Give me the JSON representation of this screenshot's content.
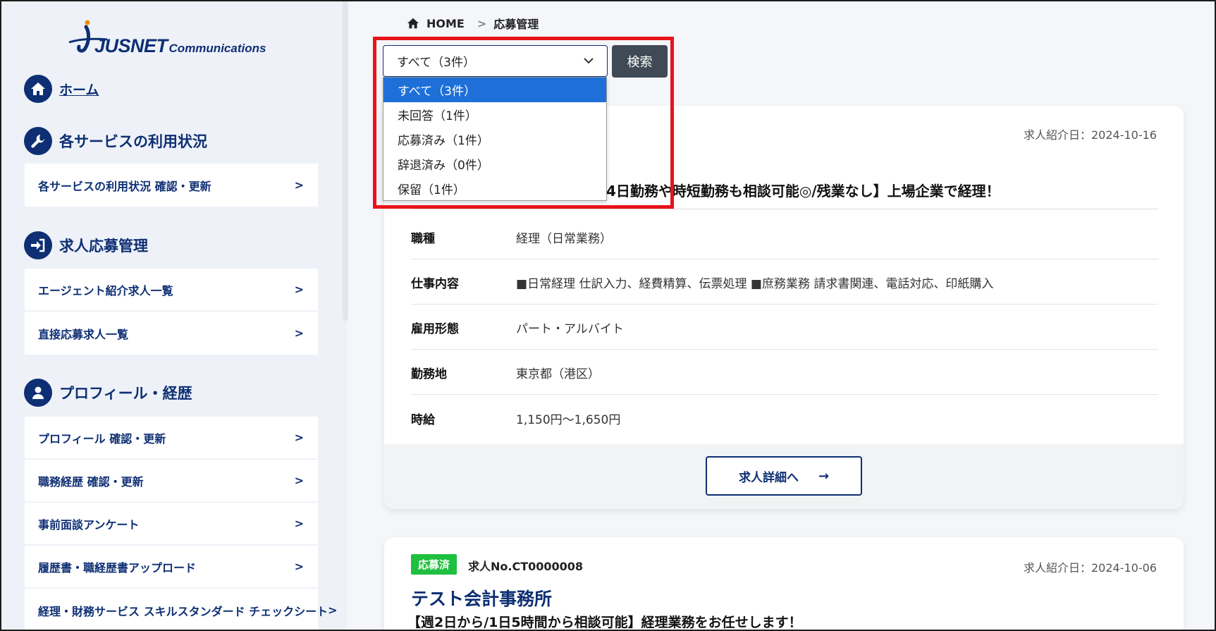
{
  "logo": {
    "brand": "JUSNET",
    "suffix": "Communications"
  },
  "sidebar": {
    "home": "ホーム",
    "sections": [
      {
        "title": "各サービスの利用状況",
        "items": [
          "各サービスの利用状況 確認・更新"
        ]
      },
      {
        "title": "求人応募管理",
        "items": [
          "エージェント紹介求人一覧",
          "直接応募求人一覧"
        ]
      },
      {
        "title": "プロフィール・経歴",
        "items": [
          "プロフィール 確認・更新",
          "職務経歴 確認・更新",
          "事前面談アンケート",
          "履歴書・職経歴書アップロード",
          "経理・財務サービス スキルスタンダード チェックシート"
        ]
      }
    ]
  },
  "breadcrumb": {
    "home": "HOME",
    "current": "応募管理"
  },
  "filter": {
    "selected": "すべて（3件）",
    "options": [
      "すべて（3件）",
      "未回答（1件）",
      "応募済み（1件）",
      "辞退済み（0件）",
      "保留（1件）"
    ],
    "search_label": "検索"
  },
  "jobs": [
    {
      "date": "求人紹介日：2024-10-16",
      "title": "4日勤務や時短勤務も相談可能◎/残業なし】上場企業で経理！",
      "rows": [
        {
          "label": "職種",
          "value": "経理（日常業務）"
        },
        {
          "label": "仕事内容",
          "value": "■日常経理 仕訳入力、経費精算、伝票処理 ■庶務業務 請求書関連、電話対応、印紙購入"
        },
        {
          "label": "雇用形態",
          "value": "パート・アルバイト"
        },
        {
          "label": "勤務地",
          "value": "東京都（港区）"
        },
        {
          "label": "時給",
          "value": "1,150円～1,650円"
        }
      ],
      "detail_button": "求人詳細へ"
    },
    {
      "status": "応募済",
      "job_no": "求人No.CT0000008",
      "date": "求人紹介日：2024-10-06",
      "company": "テスト会計事務所",
      "title": "【週2日から/1日5時間から相談可能】経理業務をお任せします！"
    }
  ],
  "colors": {
    "brand": "#0e2f73",
    "status_applied": "#1fbf3f",
    "highlight": "#e8141a",
    "selected_option": "#1e70d8"
  }
}
